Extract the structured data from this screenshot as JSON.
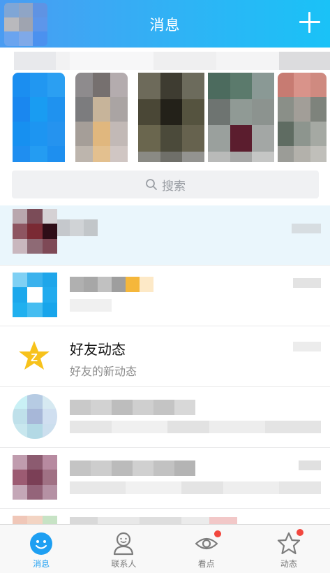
{
  "header": {
    "title": "消息",
    "add_icon": "plus-icon",
    "accent_color": "#2fb3f5"
  },
  "search": {
    "placeholder": "搜索",
    "icon": "search-icon"
  },
  "conversations": [
    {
      "id": "pinned-chat",
      "title": "",
      "subtitle": ""
    },
    {
      "id": "group-chat",
      "title": "",
      "subtitle": ""
    },
    {
      "id": "friend-feed",
      "title": "好友动态",
      "subtitle": "好友的新动态",
      "icon": "qzone-star-icon"
    },
    {
      "id": "chat-4",
      "title": "",
      "subtitle": ""
    },
    {
      "id": "chat-5",
      "title": "",
      "subtitle": ""
    }
  ],
  "tabbar": {
    "tabs": [
      {
        "label": "消息",
        "icon": "message-icon",
        "active": true,
        "badge": false
      },
      {
        "label": "联系人",
        "icon": "contacts-icon",
        "active": false,
        "badge": false
      },
      {
        "label": "看点",
        "icon": "eye-icon",
        "active": false,
        "badge": true
      },
      {
        "label": "动态",
        "icon": "star-icon",
        "active": false,
        "badge": true
      }
    ],
    "active_color": "#1e9ff2",
    "badge_color": "#f2473e"
  }
}
